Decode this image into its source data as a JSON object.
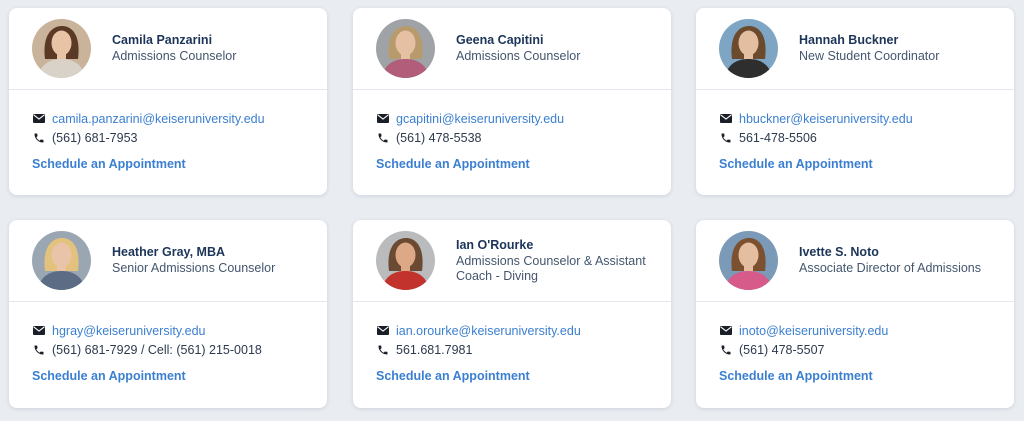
{
  "cards": [
    {
      "name": "Camila Panzarini",
      "title": "Admissions Counselor",
      "email": "camila.panzarini@keiseruniversity.edu",
      "phone": "(561) 681-7953",
      "schedule_label": "Schedule an Appointment",
      "avatar_colors": {
        "bg": "#c9b39b",
        "hair": "#5a3a24",
        "skin": "#e8c3a6",
        "shirt": "#d9d2c8"
      }
    },
    {
      "name": "Geena Capitini",
      "title": "Admissions Counselor",
      "email": "gcapitini@keiseruniversity.edu",
      "phone": "(561) 478-5538",
      "schedule_label": "Schedule an Appointment",
      "avatar_colors": {
        "bg": "#9fa3a8",
        "hair": "#b89b6c",
        "skin": "#e6c0a2",
        "shirt": "#b25d7a"
      }
    },
    {
      "name": "Hannah Buckner",
      "title": "New Student Coordinator",
      "email": "hbuckner@keiseruniversity.edu",
      "phone": "561-478-5506",
      "schedule_label": "Schedule an Appointment",
      "avatar_colors": {
        "bg": "#7ea6c4",
        "hair": "#6b4a2e",
        "skin": "#e4bea0",
        "shirt": "#2e2e2e"
      }
    },
    {
      "name": "Heather Gray, MBA",
      "title": "Senior Admissions Counselor",
      "email": "hgray@keiseruniversity.edu",
      "phone": "(561) 681-7929 / Cell: (561) 215-0018",
      "schedule_label": "Schedule an Appointment",
      "avatar_colors": {
        "bg": "#9aa7b3",
        "hair": "#e2c27c",
        "skin": "#e9c4a8",
        "shirt": "#5b6c84"
      }
    },
    {
      "name": "Ian O'Rourke",
      "title": "Admissions Counselor & Assistant Coach - Diving",
      "email": "ian.orourke@keiseruniversity.edu",
      "phone": "561.681.7981",
      "schedule_label": "Schedule an Appointment",
      "avatar_colors": {
        "bg": "#b9bbbd",
        "hair": "#6a4a32",
        "skin": "#dca886",
        "shirt": "#c2332e"
      }
    },
    {
      "name": "Ivette S. Noto",
      "title": "Associate Director of Admissions",
      "email": "inoto@keiseruniversity.edu",
      "phone": "(561) 478-5507",
      "schedule_label": "Schedule an Appointment",
      "avatar_colors": {
        "bg": "#7a9ab8",
        "hair": "#7b5130",
        "skin": "#e5bda1",
        "shirt": "#d65a8a"
      }
    }
  ]
}
